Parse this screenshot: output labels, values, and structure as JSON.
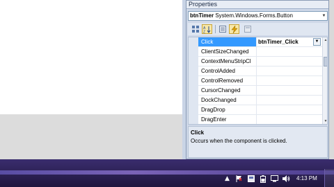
{
  "props_panel": {
    "title": "Properties",
    "selector": {
      "object_name": "btnTimer",
      "object_type": "System.Windows.Forms.Button"
    },
    "toolbar": [
      {
        "name": "categorized-icon",
        "glyph": "▦"
      },
      {
        "name": "alphabetical-icon",
        "glyph": "A↓"
      },
      {
        "name": "properties-icon",
        "glyph": "▤"
      },
      {
        "name": "events-icon",
        "glyph": "⚡",
        "active": true
      },
      {
        "name": "property-pages-icon",
        "glyph": "▭"
      }
    ],
    "rows": [
      {
        "name": "Click",
        "value": "btnTimer_Click",
        "selected": true
      },
      {
        "name": "ClientSizeChanged",
        "value": ""
      },
      {
        "name": "ContextMenuStripCl",
        "value": ""
      },
      {
        "name": "ControlAdded",
        "value": ""
      },
      {
        "name": "ControlRemoved",
        "value": ""
      },
      {
        "name": "CursorChanged",
        "value": ""
      },
      {
        "name": "DockChanged",
        "value": ""
      },
      {
        "name": "DragDrop",
        "value": ""
      },
      {
        "name": "DragEnter",
        "value": ""
      }
    ],
    "description": {
      "title": "Click",
      "text": "Occurs when the component is clicked."
    }
  },
  "taskbar": {
    "clock": "4:13 PM",
    "tray_icons": [
      {
        "name": "show-hidden-icons-icon",
        "glyph": "▲"
      },
      {
        "name": "action-center-flag-icon",
        "glyph": "⚑"
      },
      {
        "name": "app-tray-icon",
        "glyph": "▣"
      },
      {
        "name": "power-icon",
        "glyph": "▮"
      },
      {
        "name": "network-icon",
        "glyph": "▥"
      },
      {
        "name": "volume-icon",
        "glyph": "🔈"
      }
    ]
  },
  "colors": {
    "selection": "#3399ff",
    "taskbar": "#2b2050",
    "panel": "#cfd8e8"
  }
}
